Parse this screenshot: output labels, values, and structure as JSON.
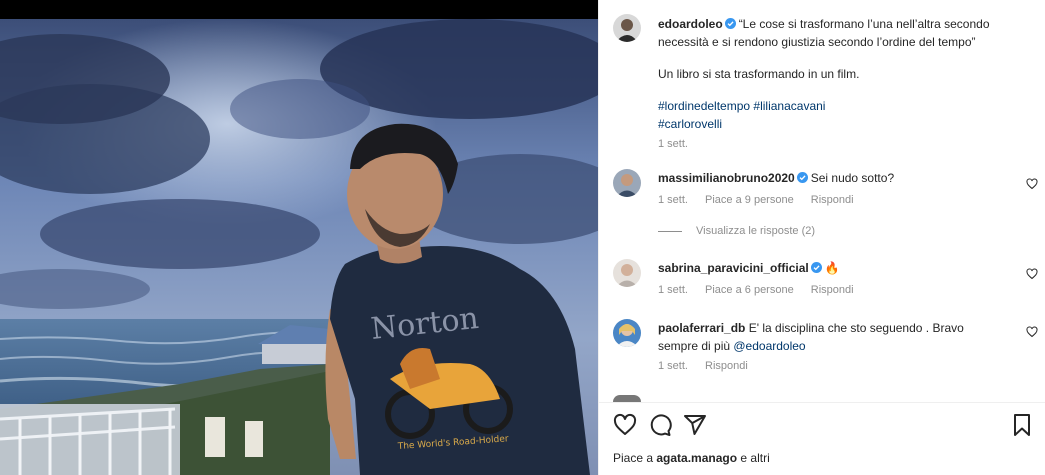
{
  "post": {
    "author": "edoardoleo",
    "caption_line1": "“Le cose si trasformano l’una nell’altra secondo necessità e si rendono giustizia secondo l’ordine del tempo”",
    "caption_line2": "Un libro si sta trasformando in un film.",
    "hashtags": [
      "#lordinedeltempo",
      "#lilianacavani",
      "#carlorovelli"
    ],
    "time": "1 sett."
  },
  "comments": [
    {
      "user": "massimilianobruno2020",
      "verified": true,
      "text": "Sei nudo sotto?",
      "time": "1 sett.",
      "likes": "Piace a 9 persone",
      "reply": "Rispondi"
    },
    {
      "user": "sabrina_paravicini_official",
      "verified": true,
      "text": "🔥",
      "time": "1 sett.",
      "likes": "Piace a 6 persone",
      "reply": "Rispondi"
    },
    {
      "user": "paolaferrari_db",
      "verified": false,
      "text": "E' la disciplina che sto seguendo . Bravo sempre di più ",
      "mention": "@edoardoleo",
      "time": "1 sett.",
      "reply": "Rispondi"
    }
  ],
  "view_replies": "Visualizza le risposte (2)",
  "likes": {
    "prefix": "Piace a ",
    "user": "agata.manago",
    "suffix": " e altri"
  },
  "icons": {
    "like": "heart-icon",
    "comment": "comment-icon",
    "share": "share-icon",
    "save": "bookmark-icon",
    "verified": "verified-badge-icon"
  },
  "colors": {
    "verified": "#3897f0",
    "link": "#00376b",
    "muted": "#8e8e8e",
    "text": "#262626"
  }
}
